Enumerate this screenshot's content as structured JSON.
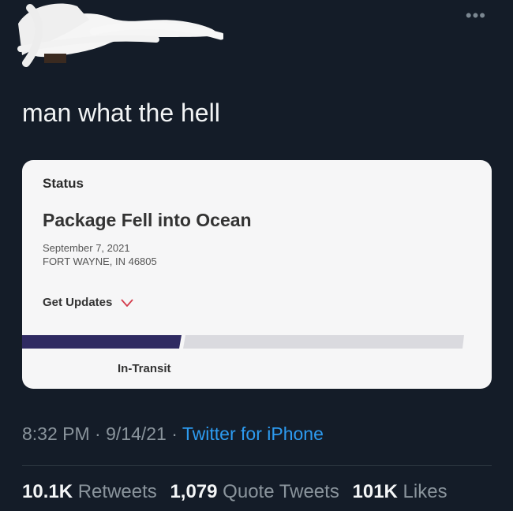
{
  "tweet": {
    "text": "man what the hell",
    "time": "8:32 PM",
    "date": "9/14/21",
    "source": "Twitter for iPhone",
    "separator": "·"
  },
  "card": {
    "status_label": "Status",
    "status_title": "Package Fell into Ocean",
    "date": "September 7, 2021",
    "location": "FORT WAYNE, IN 46805",
    "get_updates": "Get Updates",
    "progress_label": "In-Transit",
    "progress_fraction": 0.36
  },
  "stats": {
    "retweets_count": "10.1K",
    "retweets_label": "Retweets",
    "quotes_count": "1,079",
    "quotes_label": "Quote Tweets",
    "likes_count": "101K",
    "likes_label": "Likes"
  },
  "colors": {
    "background": "#141c28",
    "card": "#f6f6f7",
    "progress_fill": "#2f2a62",
    "progress_track": "#dadadf",
    "link": "#2d9bf0",
    "chevron": "#d33a4a"
  },
  "icons": {
    "more": "more-horizontal-icon",
    "chevron": "chevron-down-icon"
  }
}
